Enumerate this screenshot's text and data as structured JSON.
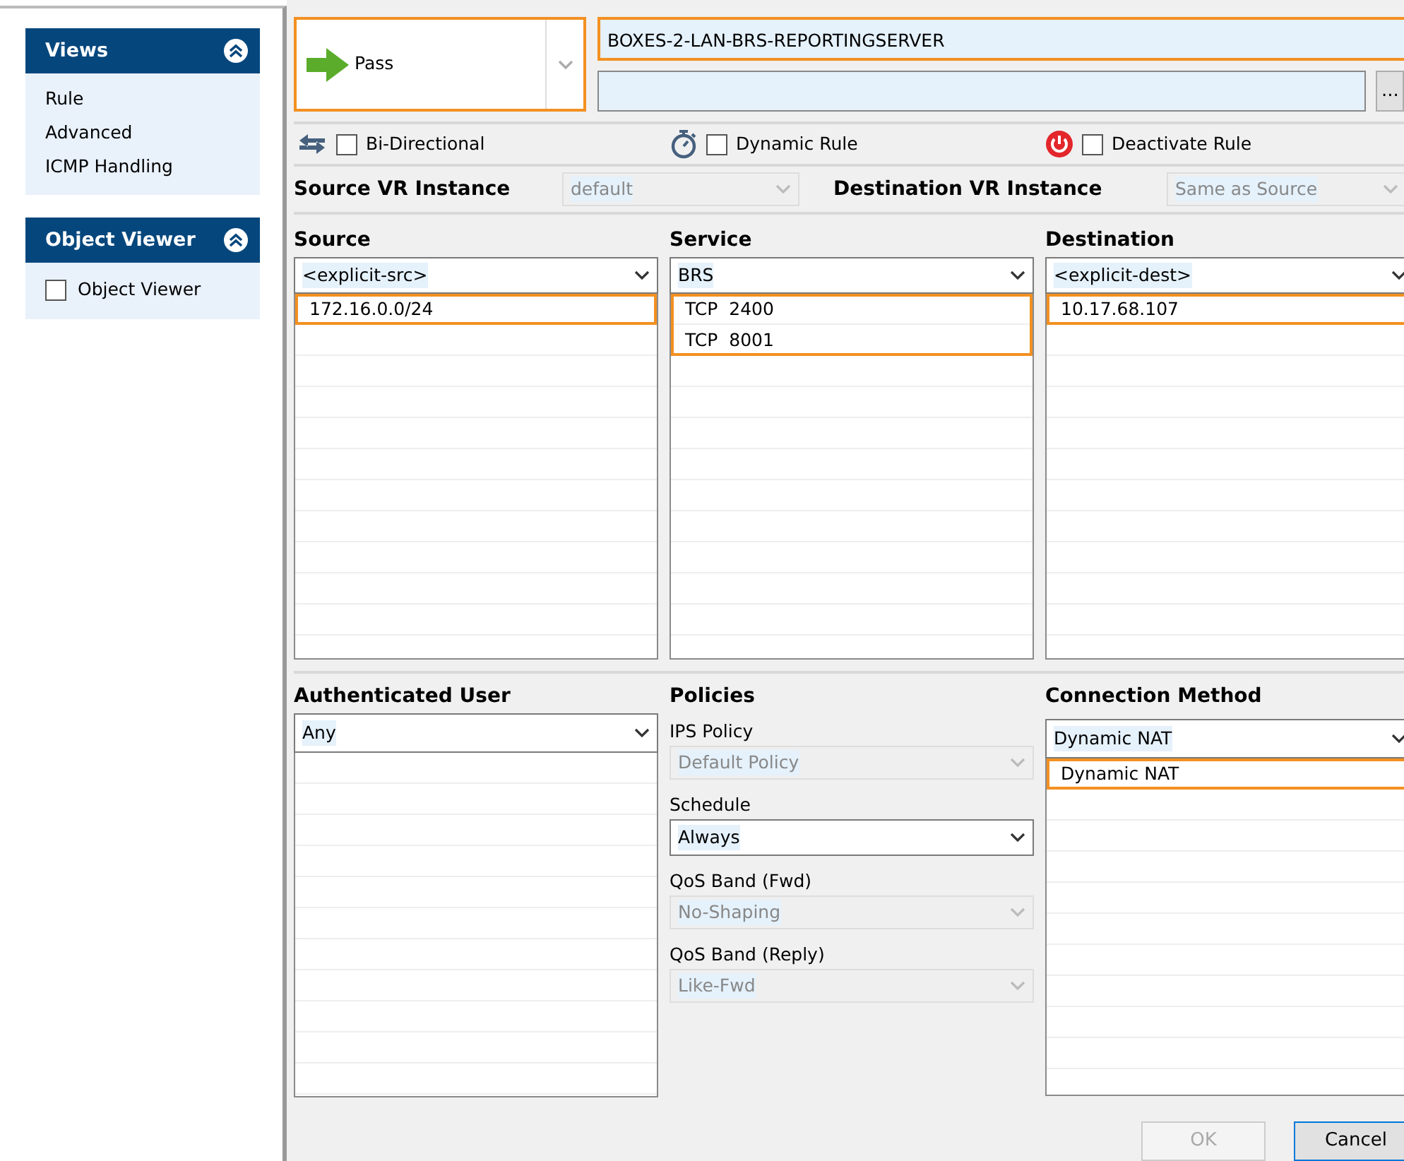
{
  "sidebar": {
    "panels": [
      {
        "title": "Views",
        "expanded": true,
        "items": [
          {
            "kind": "link",
            "label": "Rule"
          },
          {
            "kind": "link",
            "label": "Advanced"
          },
          {
            "kind": "link",
            "label": "ICMP Handling"
          }
        ]
      },
      {
        "title": "Object Viewer",
        "expanded": true,
        "items": [
          {
            "kind": "checkbox",
            "label": "Object Viewer",
            "checked": false
          }
        ]
      }
    ]
  },
  "action": {
    "label": "Pass",
    "highlighted": true
  },
  "rule_name": {
    "value": "BOXES-2-LAN-BRS-REPORTINGSERVER",
    "highlighted": true
  },
  "browse_button": "...",
  "options": [
    {
      "kind": "bidirectional",
      "label": "Bi-Directional",
      "checked": false
    },
    {
      "kind": "timer",
      "label": "Dynamic Rule",
      "checked": false
    },
    {
      "kind": "power",
      "label": "Deactivate Rule",
      "checked": false
    }
  ],
  "vr_instances": [
    {
      "label": "Source VR Instance",
      "value": "default",
      "disabled": true
    },
    {
      "label": "Destination VR Instance",
      "value": "Same as Source",
      "disabled": true
    }
  ],
  "objects": [
    {
      "title": "Source",
      "selection": "<explicit-src>",
      "entries": [
        "172.16.0.0/24"
      ],
      "highlighted": true
    },
    {
      "title": "Service",
      "selection": "BRS",
      "entries": [
        "TCP  2400",
        "TCP  8001"
      ],
      "highlighted": true
    },
    {
      "title": "Destination",
      "selection": "<explicit-dest>",
      "entries": [
        "10.17.68.107"
      ],
      "highlighted": true
    }
  ],
  "authenticated_user": {
    "title": "Authenticated User",
    "selection": "Any"
  },
  "policies": {
    "title": "Policies",
    "fields": [
      {
        "label": "IPS Policy",
        "value": "Default Policy",
        "disabled": true
      },
      {
        "label": "Schedule",
        "value": "Always",
        "disabled": false
      },
      {
        "label": "QoS Band (Fwd)",
        "value": "No-Shaping",
        "disabled": true
      },
      {
        "label": "QoS Band (Reply)",
        "value": "Like-Fwd",
        "disabled": true
      }
    ]
  },
  "connection_method": {
    "title": "Connection Method",
    "selection": "Dynamic NAT",
    "entries": [
      "Dynamic NAT"
    ],
    "highlighted": true
  },
  "buttons": [
    {
      "label": "OK",
      "disabled": true
    },
    {
      "label": "Cancel",
      "disabled": false
    }
  ]
}
